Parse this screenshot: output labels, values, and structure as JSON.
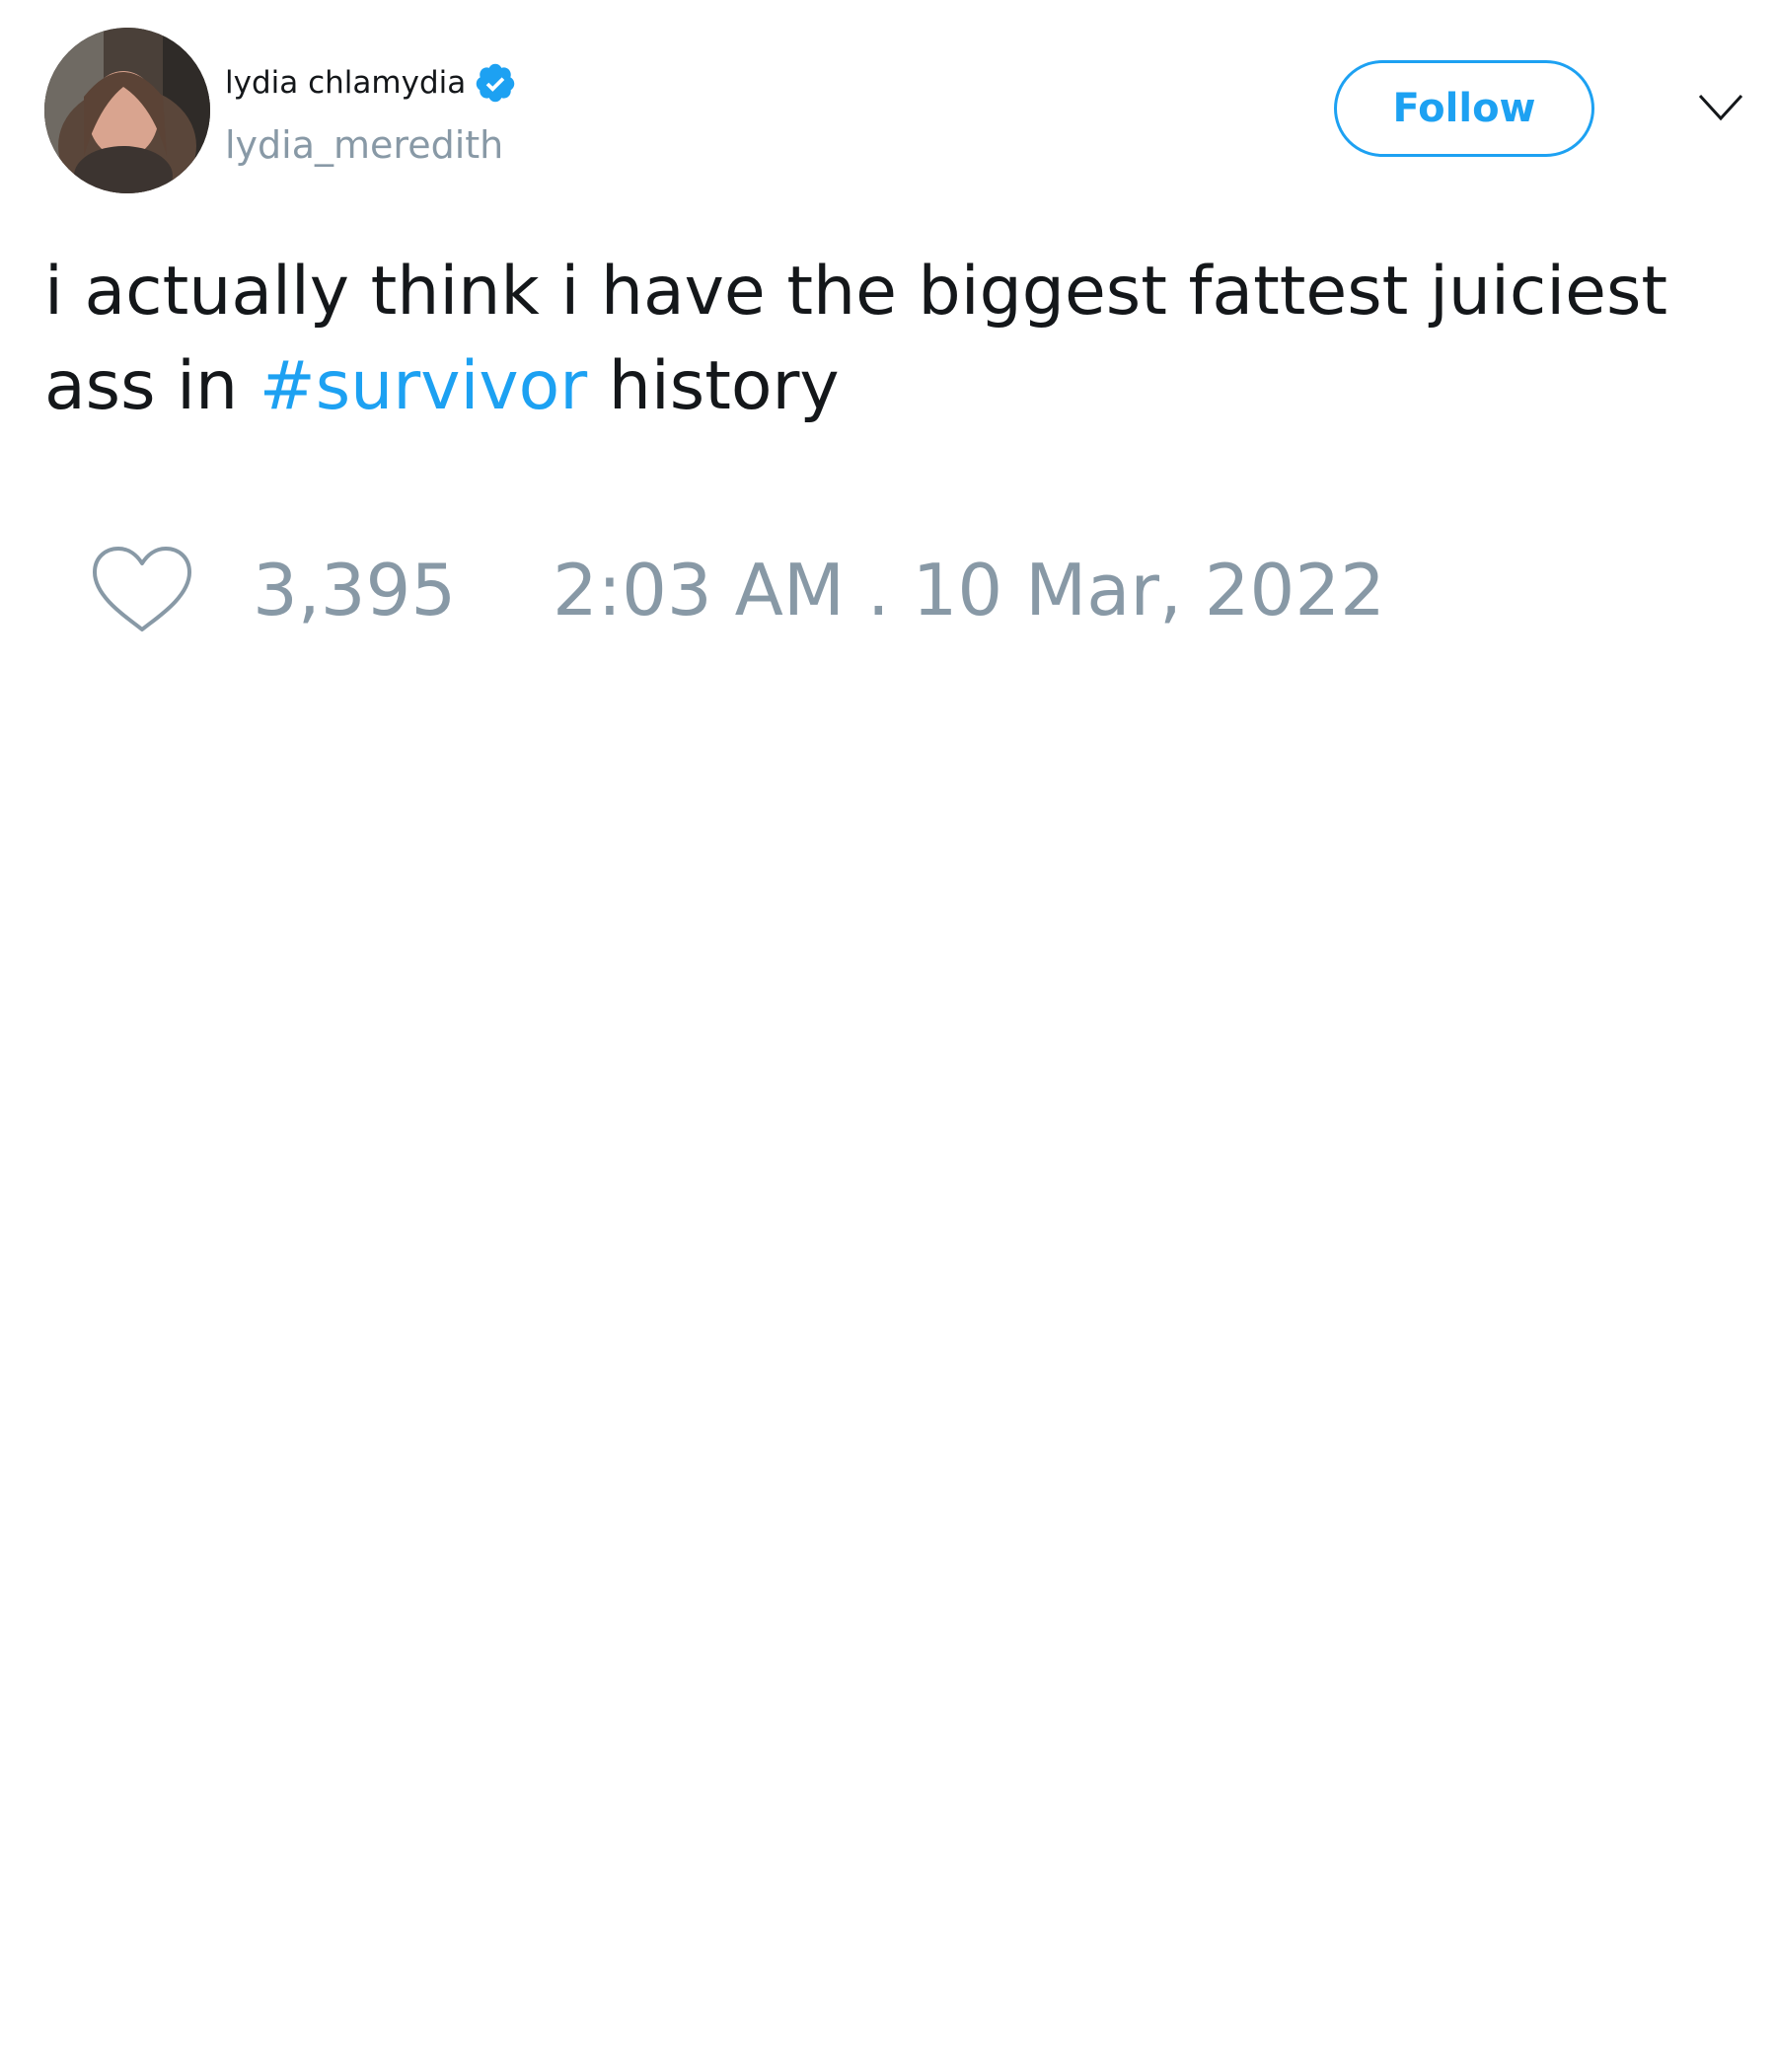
{
  "user": {
    "display_name": "lydia chlamydia",
    "handle": "lydia_meredith",
    "verified": true,
    "avatar_icon": "profile-photo"
  },
  "actions": {
    "follow_label": "Follow",
    "menu_icon": "chevron-down-icon"
  },
  "tweet": {
    "text_before": "i actually think i have the biggest fattest juiciest ass in ",
    "hashtag": "#survivor",
    "text_after": " history"
  },
  "footer": {
    "like_icon": "heart-icon",
    "like_count": "3,395",
    "timestamp": "2:03 AM . 10 Mar, 2022"
  },
  "colors": {
    "accent": "#1da1f2",
    "text": "#14171a",
    "secondary_text": "#8899a6",
    "background": "#ffffff"
  }
}
